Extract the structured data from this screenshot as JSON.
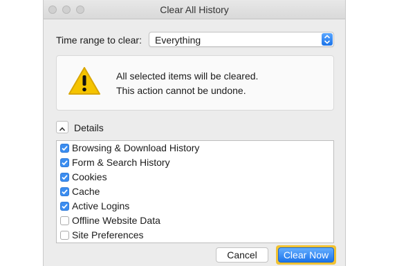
{
  "window": {
    "title": "Clear All History"
  },
  "time_range": {
    "label": "Time range to clear:",
    "selected": "Everything"
  },
  "warning": {
    "line1": "All selected items will be cleared.",
    "line2": "This action cannot be undone."
  },
  "details": {
    "label": "Details"
  },
  "items": [
    {
      "label": "Browsing & Download History",
      "checked": true
    },
    {
      "label": "Form & Search History",
      "checked": true
    },
    {
      "label": "Cookies",
      "checked": true
    },
    {
      "label": "Cache",
      "checked": true
    },
    {
      "label": "Active Logins",
      "checked": true
    },
    {
      "label": "Offline Website Data",
      "checked": false
    },
    {
      "label": "Site Preferences",
      "checked": false
    }
  ],
  "buttons": {
    "cancel": "Cancel",
    "clear_now": "Clear Now"
  },
  "colors": {
    "accent": "#1c74ea",
    "highlight": "#f1c232",
    "warning": "#f5c400"
  },
  "icons": {
    "warning": "warning-triangle-icon",
    "toggle": "chevron-up-icon",
    "select": "select-arrows-icon"
  }
}
